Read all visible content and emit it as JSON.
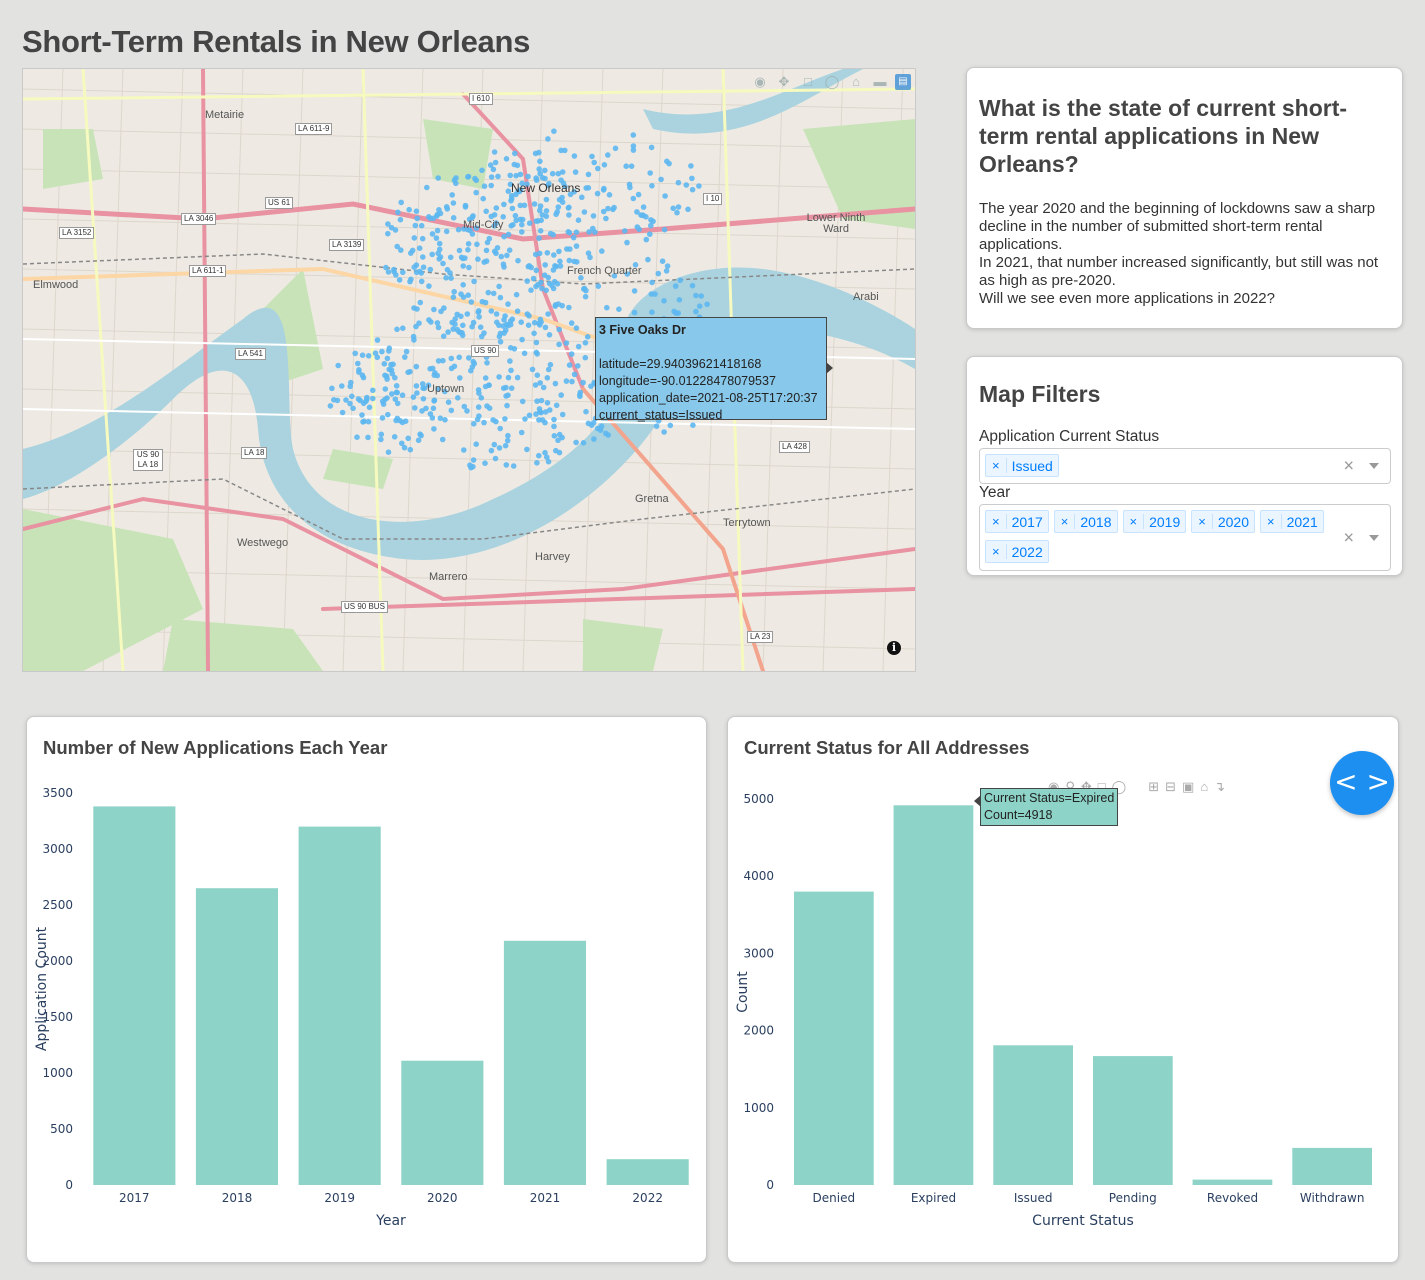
{
  "page_title": "Short-Term Rentals in New Orleans",
  "map": {
    "place_labels": [
      {
        "name": "Metairie"
      },
      {
        "name": "New Orleans"
      },
      {
        "name": "Mid-City"
      },
      {
        "name": "French Quarter"
      },
      {
        "name": "Lower Ninth Ward"
      },
      {
        "name": "Elmwood"
      },
      {
        "name": "Uptown"
      },
      {
        "name": "Gretna"
      },
      {
        "name": "Westwego"
      },
      {
        "name": "Terrytown"
      },
      {
        "name": "Harvey"
      },
      {
        "name": "Marrero"
      },
      {
        "name": "Arabi"
      }
    ],
    "highway_labels": [
      "I 610",
      "LA 611-9",
      "US 61",
      "LA 3046",
      "LA 3152",
      "LA 3139",
      "LA 611-1",
      "US 90",
      "LA 541",
      "US 90 LA 18",
      "LA 18",
      "LA 428",
      "US 90 BUS",
      "LA 23",
      "I 10"
    ],
    "tooltip": {
      "title": "3 Five Oaks Dr",
      "latitude": "latitude=29.94039621418168",
      "longitude": "longitude=-90.01228478079537",
      "application_date": "application_date=2021-08-25T17:20:37",
      "current_status": "current_status=Issued"
    },
    "modebar_icons": [
      "camera-icon",
      "pan-icon",
      "box-select-icon",
      "lasso-icon",
      "home-icon",
      "spike-icon",
      "plotly-logo-icon"
    ],
    "point_color": "#5db7ef"
  },
  "info": {
    "heading": "What is the state of current short-term rental applications in New Orleans?",
    "paragraph_lines": [
      "The year 2020 and the beginning of lockdowns saw a sharp decline in the number of submitted short-term rental applications.",
      "In 2021, that number increased significantly, but still was not as high as pre-2020.",
      "Will we see even more applications in 2022?"
    ]
  },
  "filters": {
    "heading": "Map Filters",
    "status_label": "Application Current Status",
    "status_selected": [
      "Issued"
    ],
    "year_label": "Year",
    "year_selected": [
      "2017",
      "2018",
      "2019",
      "2020",
      "2021",
      "2022"
    ]
  },
  "charts": {
    "applications_title": "Number of New Applications Each Year",
    "status_title": "Current Status for All Addresses",
    "status_tooltip": {
      "line1": "Current Status=Expired",
      "line2": "Count=4918"
    }
  },
  "chart_data": [
    {
      "type": "bar",
      "title": "Number of New Applications Each Year",
      "categories": [
        "2017",
        "2018",
        "2019",
        "2020",
        "2021",
        "2022"
      ],
      "values": [
        3380,
        2650,
        3200,
        1110,
        2180,
        230
      ],
      "xlabel": "Year",
      "ylabel": "Application Count",
      "ylim": [
        0,
        3500
      ],
      "yticks": [
        0,
        500,
        1000,
        1500,
        2000,
        2500,
        3000,
        3500
      ],
      "color": "#8dd3c7"
    },
    {
      "type": "bar",
      "title": "Current Status for All Addresses",
      "categories": [
        "Denied",
        "Expired",
        "Issued",
        "Pending",
        "Revoked",
        "Withdrawn"
      ],
      "values": [
        3800,
        4918,
        1810,
        1670,
        70,
        480
      ],
      "xlabel": "Current Status",
      "ylabel": "Count",
      "ylim": [
        0,
        5000
      ],
      "yticks": [
        0,
        1000,
        2000,
        3000,
        4000,
        5000
      ],
      "color": "#8dd3c7"
    }
  ],
  "code_fab_label": "< >"
}
